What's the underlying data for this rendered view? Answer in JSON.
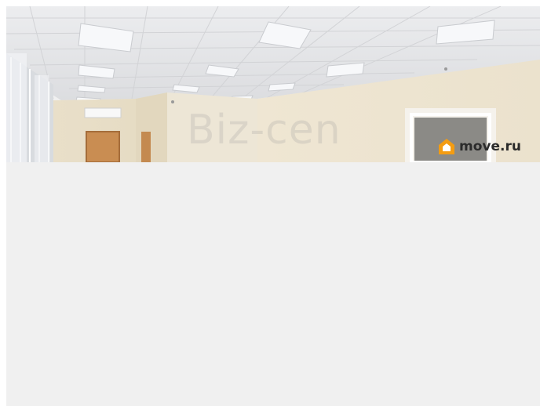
{
  "photo": {
    "watermark_text": "Biz-cen",
    "logo_text": "move.ru",
    "logo_icon": "house-icon",
    "accent_color": "#f39c12"
  }
}
